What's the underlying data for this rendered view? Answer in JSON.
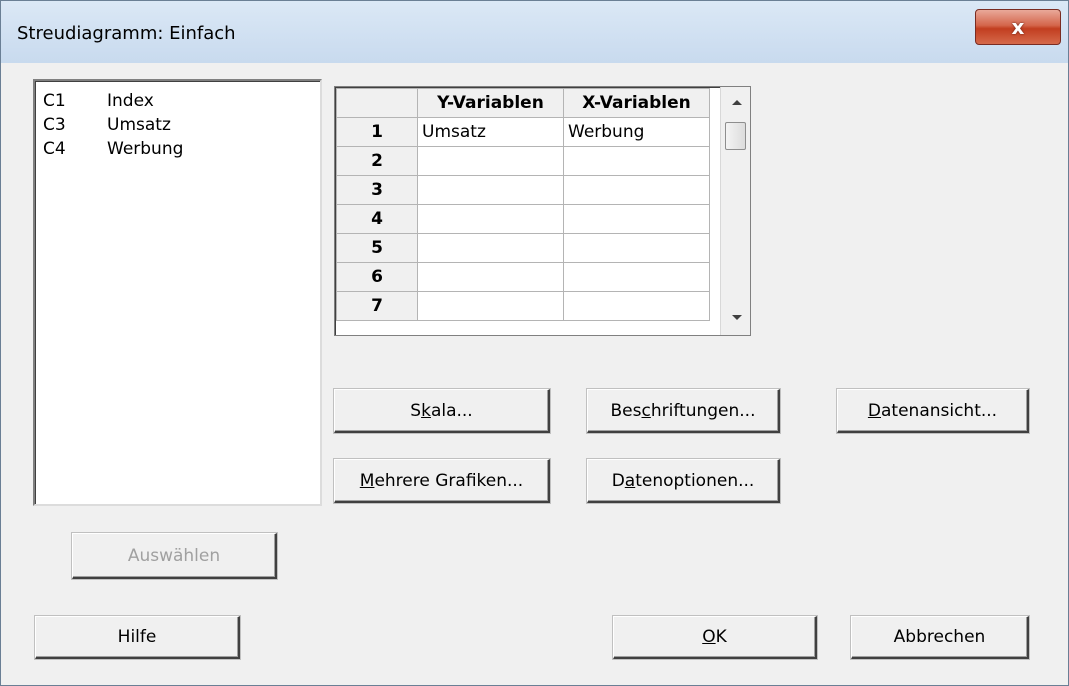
{
  "window": {
    "title": "Streudiagramm: Einfach",
    "close_label": "x"
  },
  "variables": [
    {
      "col": "C1",
      "name": "Index"
    },
    {
      "col": "C3",
      "name": "Umsatz"
    },
    {
      "col": "C4",
      "name": "Werbung"
    }
  ],
  "grid": {
    "headers": [
      "Y-Variablen",
      "X-Variablen"
    ],
    "rows": [
      {
        "num": "1",
        "y": "Umsatz",
        "x": "Werbung"
      },
      {
        "num": "2",
        "y": "",
        "x": ""
      },
      {
        "num": "3",
        "y": "",
        "x": ""
      },
      {
        "num": "4",
        "y": "",
        "x": ""
      },
      {
        "num": "5",
        "y": "",
        "x": ""
      },
      {
        "num": "6",
        "y": "",
        "x": ""
      },
      {
        "num": "7",
        "y": "",
        "x": ""
      }
    ]
  },
  "buttons": {
    "skala": {
      "pre": "S",
      "acc": "k",
      "post": "ala..."
    },
    "beschriftungen": {
      "pre": "Bes",
      "acc": "c",
      "post": "hriftungen..."
    },
    "datenansicht": {
      "pre": "",
      "acc": "D",
      "post": "atenansicht..."
    },
    "mehrere": {
      "pre": "",
      "acc": "M",
      "post": "ehrere Grafiken..."
    },
    "datenoptionen": {
      "pre": "D",
      "acc": "a",
      "post": "tenoptionen..."
    },
    "auswaehlen": "Auswählen",
    "hilfe": "Hilfe",
    "ok": {
      "pre": "",
      "acc": "O",
      "post": "K"
    },
    "abbrechen": "Abbrechen"
  }
}
